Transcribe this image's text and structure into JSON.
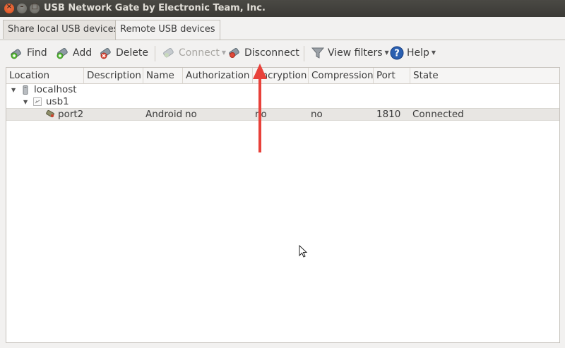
{
  "window": {
    "title": "USB Network Gate by Electronic Team, Inc.",
    "close_glyph": "×",
    "minimize_glyph": "–",
    "maximize_glyph": "□"
  },
  "tabs": [
    {
      "label": "Share local USB devices",
      "active": false
    },
    {
      "label": "Remote USB devices",
      "active": true
    }
  ],
  "toolbar": {
    "find": "Find",
    "add": "Add",
    "delete": "Delete",
    "connect": "Connect",
    "disconnect": "Disconnect",
    "view_filters": "View filters",
    "help": "Help"
  },
  "table": {
    "columns": [
      "Location",
      "Description",
      "Name",
      "Authorization",
      "Encryption",
      "Compression",
      "Port",
      "State"
    ],
    "tree": {
      "host": "localhost",
      "hub": "usb1",
      "device": {
        "location": "port2",
        "description": "",
        "name": "Android",
        "authorization": "no",
        "encryption": "no",
        "compression": "no",
        "port": "1810",
        "state": "Connected"
      }
    }
  },
  "colors": {
    "annotation_arrow": "#e8413a",
    "titlebar": "#3d3c38",
    "close_button": "#e95d2c"
  },
  "icons": {
    "find": "find-icon",
    "add": "add-icon",
    "delete": "delete-icon",
    "connect": "connect-icon",
    "disconnect": "disconnect-icon",
    "view_filters": "funnel-icon",
    "help": "help-icon"
  }
}
